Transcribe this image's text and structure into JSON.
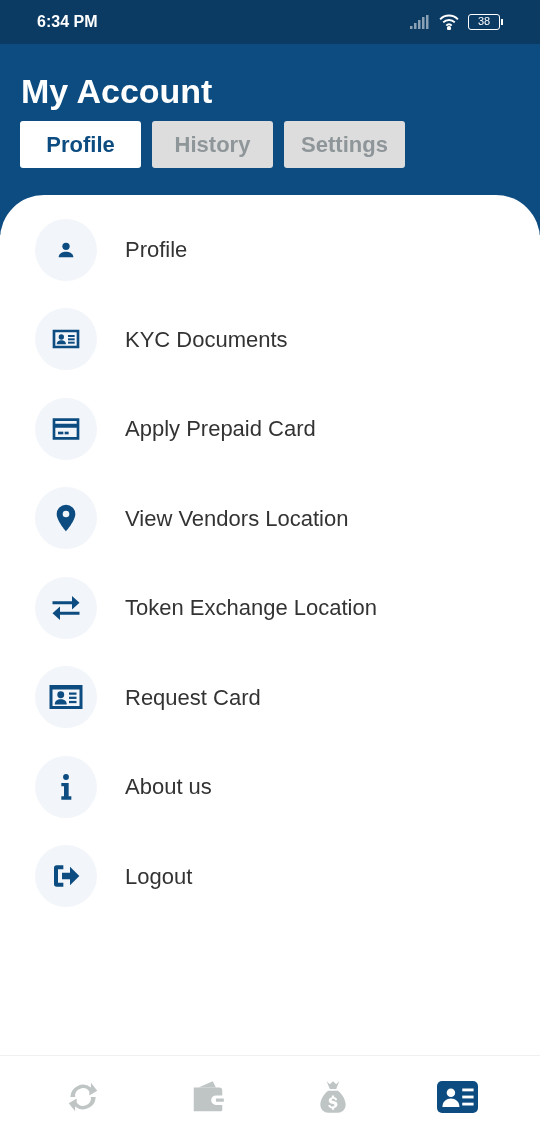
{
  "status_bar": {
    "time": "6:34 PM",
    "battery": "38"
  },
  "header": {
    "title": "My Account"
  },
  "tabs": [
    {
      "label": "Profile",
      "selected": true
    },
    {
      "label": "History",
      "selected": false
    },
    {
      "label": "Settings",
      "selected": false
    }
  ],
  "menu": [
    {
      "kind": "person",
      "label": "Profile"
    },
    {
      "kind": "idcard",
      "label": "KYC Documents"
    },
    {
      "kind": "card",
      "label": "Apply Prepaid Card"
    },
    {
      "kind": "pin",
      "label": "View Vendors Location"
    },
    {
      "kind": "exchange",
      "label": "Token Exchange Location"
    },
    {
      "kind": "idcard_large",
      "label": "Request Card"
    },
    {
      "kind": "info",
      "label": "About us"
    },
    {
      "kind": "logout",
      "label": "Logout"
    }
  ],
  "bottom_nav": [
    {
      "kind": "sync",
      "selected": false
    },
    {
      "kind": "wallet",
      "selected": false
    },
    {
      "kind": "moneybag",
      "selected": false
    },
    {
      "kind": "idcard",
      "selected": true
    }
  ]
}
